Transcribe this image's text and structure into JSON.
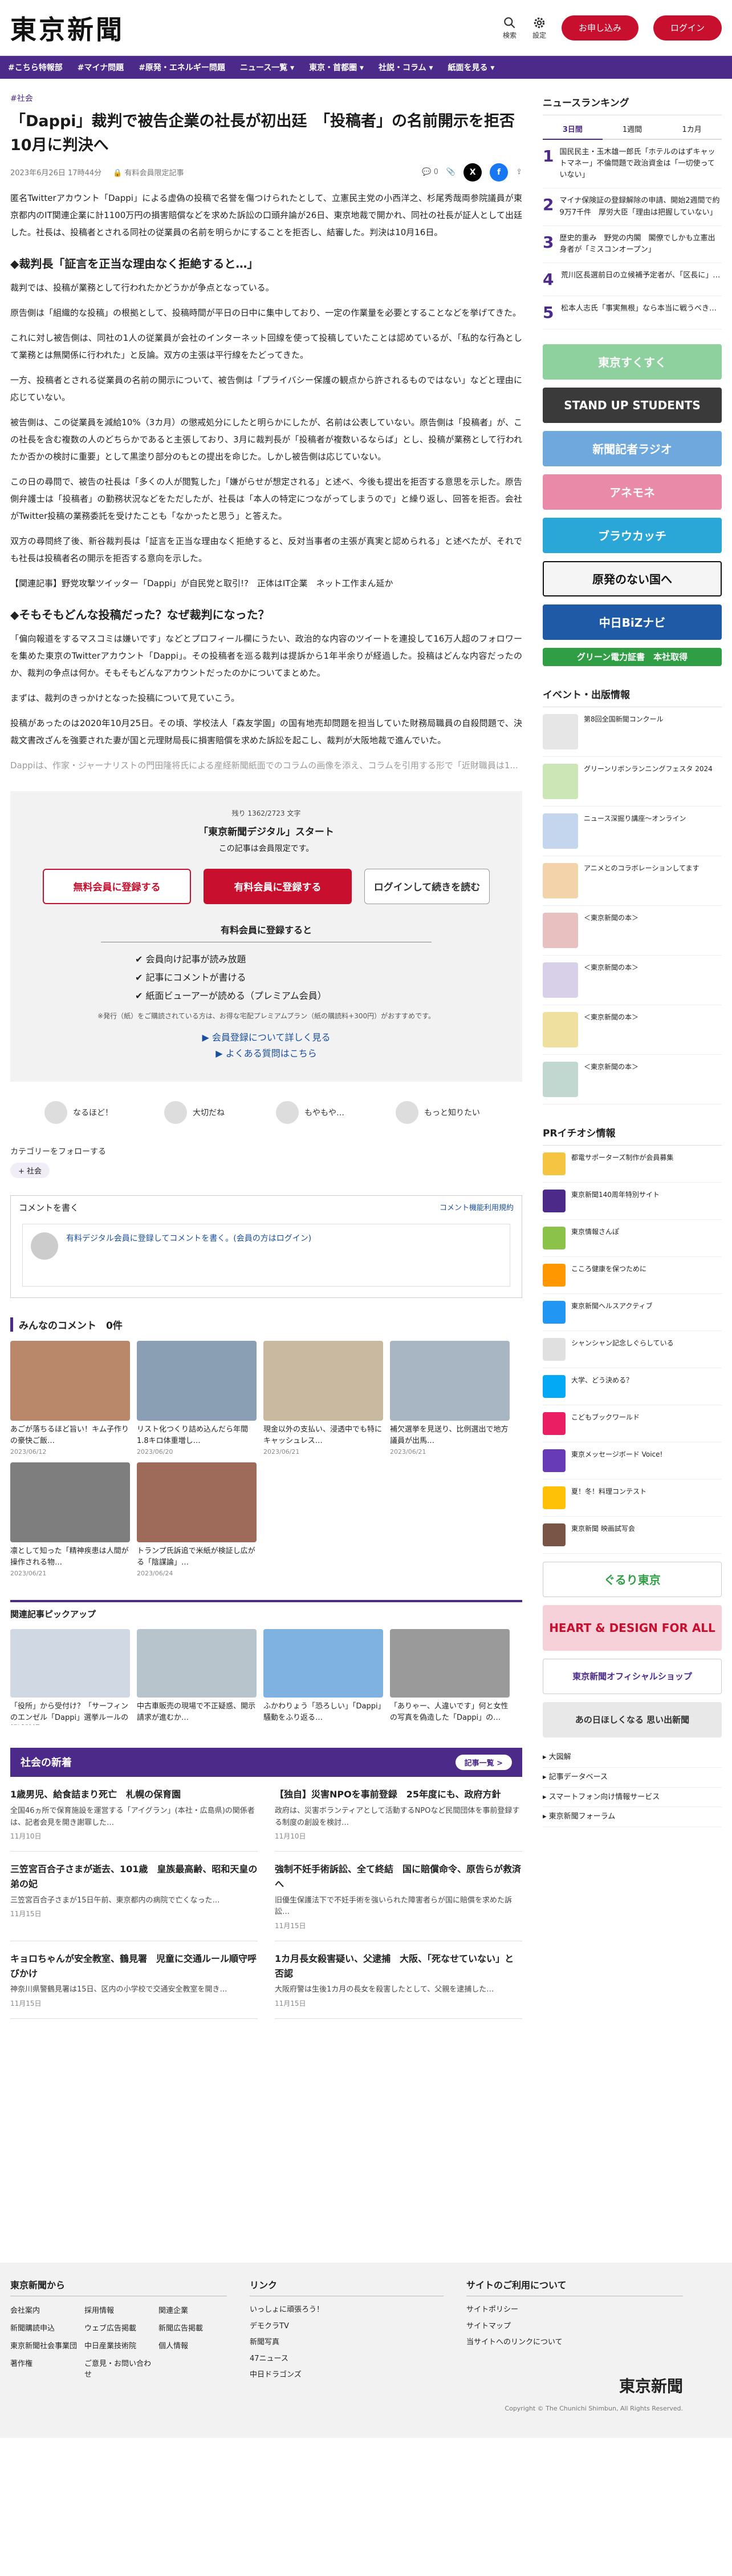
{
  "header": {
    "logo": "東京新聞",
    "search": "検索",
    "settings": "設定",
    "register": "お申し込み",
    "login": "ログイン"
  },
  "nav": [
    "#こちら特報部",
    "#マイナ問題",
    "#原発・エネルギー問題",
    "ニュース一覧 ▾",
    "東京・首都圏 ▾",
    "社説・コラム ▾",
    "紙面を見る ▾"
  ],
  "article": {
    "category": "#社会",
    "title": "「Dappi」裁判で被告企業の社長が初出廷　「投稿者」の名前開示を拒否　10月に判決へ",
    "date": "2023年6月26日 17時44分",
    "badge": "有料会員限定記事",
    "comments": "0",
    "paragraphs": [
      "匿名Twitterアカウント「Dappi」による虚偽の投稿で名誉を傷つけられたとして、立憲民主党の小西洋之、杉尾秀哉両参院議員が東京都内のIT関連企業に計1100万円の損害賠償などを求めた訴訟の口頭弁論が26日、東京地裁で開かれ、同社の社長が証人として出廷した。社長は、投稿者とされる同社の従業員の名前を明らかにすることを拒否し、結審した。判決は10月16日。",
      "◆裁判長「証言を正当な理由なく拒絶すると…」",
      "裁判では、投稿が業務として行われたかどうかが争点となっている。",
      "原告側は「組織的な投稿」の根拠として、投稿時間が平日の日中に集中しており、一定の作業量を必要とすることなどを挙げてきた。",
      "これに対し被告側は、同社の1人の従業員が会社のインターネット回線を使って投稿していたことは認めているが、「私的な行為として業務とは無関係に行われた」と反論。双方の主張は平行線をたどってきた。",
      "一方、投稿者とされる従業員の名前の開示について、被告側は「プライバシー保護の観点から許されるものではない」などと理由に応じていない。",
      "被告側は、この従業員を減給10%（3カ月）の懲戒処分にしたと明らかにしたが、名前は公表していない。原告側は「投稿者」が、この社長を含む複数の人のどちらかであると主張しており、3月に裁判長が「投稿者が複数いるならば」とし、投稿が業務として行われたか否かの検討に重要」として黒塗り部分のもとの提出を命じた。しかし被告側は応じていない。",
      "この日の尋問で、被告の社長は「多くの人が閲覧した」「嫌がらせが想定される」と述べ、今後も提出を拒否する意思を示した。原告側弁護士は「投稿者」の勤務状況などをただしたが、社長は「本人の特定につながってしまうので」と繰り返し、回答を拒否。会社がTwitter投稿の業務委託を受けたことも「なかったと思う」と答えた。",
      "双方の尋問終了後、新谷裁判長は「証言を正当な理由なく拒絶すると、反対当事者の主張が真実と認められる」と述べたが、それでも社長は投稿者名の開示を拒否する意向を示した。",
      "【関連記事】野党攻撃ツイッター「Dappi」が自民党と取引!?　正体はIT企業　ネット工作まん延か",
      "◆そもそもどんな投稿だった？なぜ裁判になった？",
      "「偏向報道をするマスコミは嫌いです」などとプロフィール欄にうたい、政治的な内容のツイートを連投して16万人超のフォロワーを集めた東京のTwitterアカウント「Dappi」。その投稿者を巡る裁判は提訴から1年半余りが経過した。投稿はどんな内容だったのか、裁判の争点は何か。そもそもどんなアカウントだったのかについてまとめた。",
      "まずは、裁判のきっかけとなった投稿について見ていこう。",
      "投稿があったのは2020年10月25日。その頃、学校法人「森友学園」の国有地売却問題を担当していた財務局職員の自殺問題で、決裁文書改ざんを強要された妻が国と元理財局長に損害賠償を求めた訴訟を起こし、裁判が大阪地裁で進んでいた。",
      "Dappiは、作家・ジャーナリストの門田隆将氏による産経新聞紙面でのコラムの画像を添え、コラムを引用する形で「近財職員は1..."
    ]
  },
  "paywall": {
    "remain": "残り 1362/2723 文字",
    "title": "「東京新聞デジタル」スタート",
    "sub": "この記事は会員限定です。",
    "free": "無料会員に登録する",
    "paid": "有料会員に登録する",
    "login": "ログインして続きを読む",
    "head": "有料会員に登録すると",
    "benefits": [
      "✔ 会員向け記事が読み放題",
      "✔ 記事にコメントが書ける",
      "✔ 紙面ビューアーが読める（プレミアム会員）"
    ],
    "note": "※発行（紙）をご購読されている方は、お得な宅配プレミアムプラン（紙の購読料+300円）がおすすめです。",
    "link1": "▶ 会員登録について詳しく見る",
    "link2": "▶ よくある質問はこちら"
  },
  "reactions": [
    "なるほど！",
    "大切だね",
    "もやもや…",
    "もっと知りたい"
  ],
  "follow": {
    "title": "カテゴリーをフォローする",
    "tag": "+ 社会"
  },
  "commentbox": {
    "title": "コメントを書く",
    "rule": "コメント機能利用規約",
    "text": "有料デジタル会員に登録してコメントを書く。(会員の方はログイン)"
  },
  "everyone": {
    "title": "みんなのコメント　0件",
    "items": [
      [
        "あごが落ちるほど旨い！キム子作りの豪快ご飯…",
        "2023/06/12"
      ],
      [
        "リスト化つくり詰め込んだら年間1.8キロ体重増し…",
        "2023/06/20"
      ],
      [
        "現金以外の支払い、浸透中でも特にキャッシュレス…",
        "2023/06/21"
      ],
      [
        "補欠選挙を見送り、比例選出で地方議員が出馬…",
        "2023/06/21"
      ],
      [
        "凛として知った「精神疾患は人間が操作される物…",
        "2023/06/21"
      ],
      [
        "トランプ氏訴追で米紙が検証し広がる「陰謀論」…",
        "2023/06/24"
      ]
    ]
  },
  "pickup": {
    "title": "関連記事ピックアップ",
    "items": [
      "「役所」から受付け？「サーフィンのエンゼル「Dappi」選挙ルールの記述確認…",
      "中古車販売の現場で不正疑惑、開示請求が進むか…",
      "ふかわりょう「恐ろしい」「Dappi」騒動をふり返る…",
      "「ありゃー、人違いです」何と女性の写真を偽造した「Dappi」の…"
    ]
  },
  "news": {
    "title": "社会の新着",
    "more": "記事一覧 >",
    "items": [
      [
        "1歳男児、給食詰まり死亡　札幌の保育園",
        "全国46ヵ所で保育施設を運営する「アイグラン」(本社・広島県)の関係者は、記者会見を開き謝罪した…",
        "11月10日"
      ],
      [
        "【独自】災害NPOを事前登録　25年度にも、政府方針",
        "政府は、災害ボランティアとして活動するNPOなど民間団体を事前登録する制度の創設を検討…",
        "11月10日"
      ],
      [
        "三笠宮百合子さまが逝去、101歳　皇族最高齢、昭和天皇の弟の妃",
        "三笠宮百合子さまが15日午前、東京都内の病院で亡くなった…",
        "11月15日"
      ],
      [
        "強制不妊手術訴訟、全て終結　国に賠償命令、原告らが救済へ",
        "旧優生保護法下で不妊手術を強いられた障害者らが国に賠償を求めた訴訟…",
        "11月15日"
      ],
      [
        "キョロちゃんが安全教室、鶴見署　児童に交通ルール順守呼びかけ",
        "神奈川県警鶴見署は15日、区内の小学校で交通安全教室を開き…",
        "11月15日"
      ],
      [
        "1カ月長女殺害疑い、父逮捕　大阪、「死なせていない」と否認",
        "大阪府警は生後1カ月の長女を殺害したとして、父親を逮捕した…",
        "11月15日"
      ]
    ]
  },
  "sidebar": {
    "rank_title": "ニュースランキング",
    "tabs": [
      "3日間",
      "1週間",
      "1カ月"
    ],
    "ranking": [
      "国民民主・玉木雄一郎氏「ホテルのはずキャットマネー」不倫問題で政治資金は「一切使っていない」",
      "マイナ保険証の登録解除の申請、開始2週間で約9万7千件　厚労大臣「理由は把握していない」",
      "歴史的重み　野党の内閣　閣僚でしかも立憲出身者が「ミスコンオープン」",
      "荒川区長選前日の立候補予定者が、「区長に」…",
      "松本人志氏「事実無根」なら本当に戦うべき…"
    ],
    "banners": [
      [
        "東京すくすく",
        "#8fd19e"
      ],
      [
        "STAND UP STUDENTS",
        "#3a3a3a"
      ],
      [
        "新聞記者ラジオ",
        "#6fa8dc"
      ],
      [
        "アネモネ",
        "#e88aa8"
      ],
      [
        "ブラウカッチ",
        "#2aa7d6"
      ],
      [
        "原発のない国へ",
        "#f5f5f5"
      ],
      [
        "中日BiZナビ",
        "#1f5aa6"
      ],
      [
        "グリーン電力証書　本社取得",
        "#2f9e44"
      ]
    ],
    "events_title": "イベント・出版情報",
    "events": [
      "第8回全国新聞コンクール",
      "グリーンリボンランニングフェスタ 2024",
      "ニュース深掘り講座〜オンライン",
      "アニメとのコラボレーションしてます",
      "＜東京新聞の本＞",
      "＜東京新聞の本＞",
      "＜東京新聞の本＞",
      "＜東京新聞の本＞"
    ],
    "pr_title": "PRイチオシ情報",
    "pr": [
      "都電サポーターズ制作が会員募集",
      "東京新聞140周年特別サイト",
      "東京情報さんぽ",
      "こころ健康を保つために",
      "東京新聞ヘルスアクティブ",
      "シャンシャン記念しぐらしている",
      "大学、どう決める？",
      "こどもブックワールド",
      "東京メッセージボード Voice!",
      "夏！冬！料理コンテスト",
      "東京新聞 映画試写会"
    ],
    "ads": [
      [
        "ぐるり東京",
        "#ffffff"
      ],
      [
        "HEART & DESIGN FOR ALL",
        "#f7d1d9"
      ],
      [
        "東京新聞オフィシャルショップ",
        "#ffffff"
      ],
      [
        "あの日ほしくなる 思い出新聞",
        "#e8e8e8"
      ]
    ],
    "links": [
      "▸ 大図解",
      "▸ 記事データベース",
      "▸ スマートフォン向け情報サービス",
      "▸ 東京新聞フォーラム"
    ]
  },
  "footer": {
    "col1": "東京新聞から",
    "col1_items": [
      "会社案内",
      "採用情報",
      "関連企業",
      "新聞購読申込",
      "ウェブ広告掲載",
      "新聞広告掲載",
      "東京新聞社会事業団",
      "中日産業技術院",
      "個人情報",
      "著作権",
      "ご意見・お問い合わせ"
    ],
    "col2": "リンク",
    "col2_items": [
      "いっしょに頑張ろう！",
      "デモクラTV",
      "新聞写真",
      "47ニュース",
      "中日ドラゴンズ"
    ],
    "col3": "サイトのご利用について",
    "col3_items": [
      "サイトポリシー",
      "サイトマップ",
      "当サイトへのリンクについて"
    ],
    "logo": "東京新聞",
    "copy": "Copyright © The Chunichi Shimbun, All Rights Reserved."
  }
}
